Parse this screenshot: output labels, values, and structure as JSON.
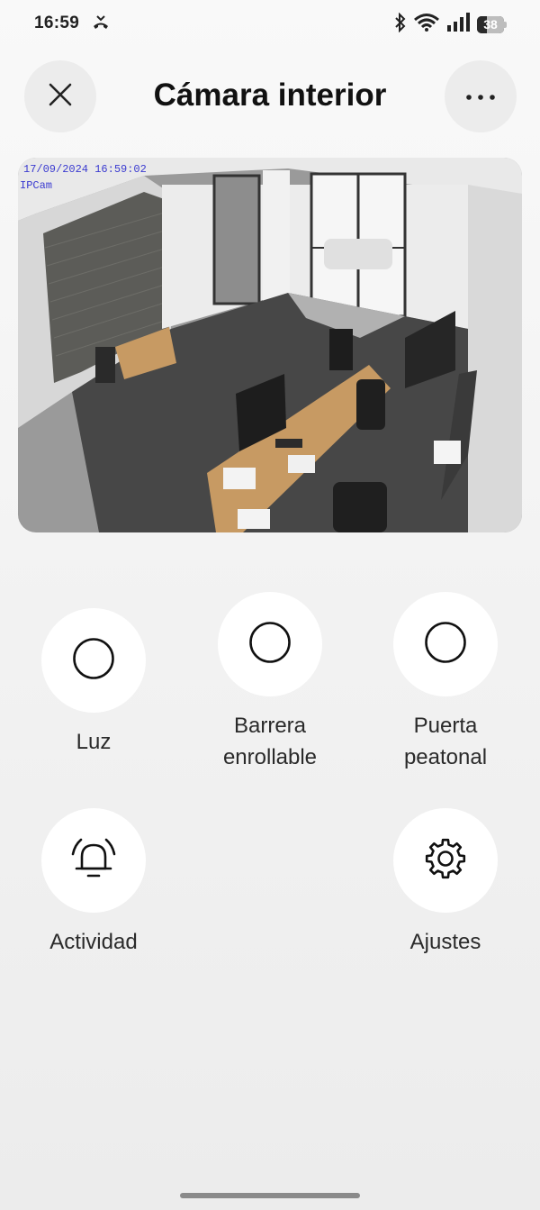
{
  "status_bar": {
    "time": "16:59",
    "battery_level": 38,
    "battery_label": "38",
    "icons": [
      "missed-call-icon",
      "bluetooth-icon",
      "wifi-icon",
      "signal-icon",
      "battery-icon"
    ]
  },
  "header": {
    "title": "Cámara interior",
    "close_icon": "close-icon",
    "more_icon": "more-options-icon"
  },
  "camera": {
    "feed": "camera-feed-image",
    "overlay_timestamp": "17/09/2024 16:59:02",
    "overlay_camera": "IPCam"
  },
  "controls": [
    {
      "label": "Luz",
      "icon": "circle-icon"
    },
    {
      "label": "Barrera enrollable",
      "icon": "circle-icon"
    },
    {
      "label": "Puerta peatonal",
      "icon": "circle-icon"
    },
    {
      "label": "Actividad",
      "icon": "bell-icon"
    },
    {
      "label": "Ajustes",
      "icon": "gear-icon"
    }
  ],
  "colors": {
    "background": "#f3f3f3",
    "button_bg": "#ececec",
    "control_bg": "#ffffff",
    "text": "#1c1c1c"
  }
}
